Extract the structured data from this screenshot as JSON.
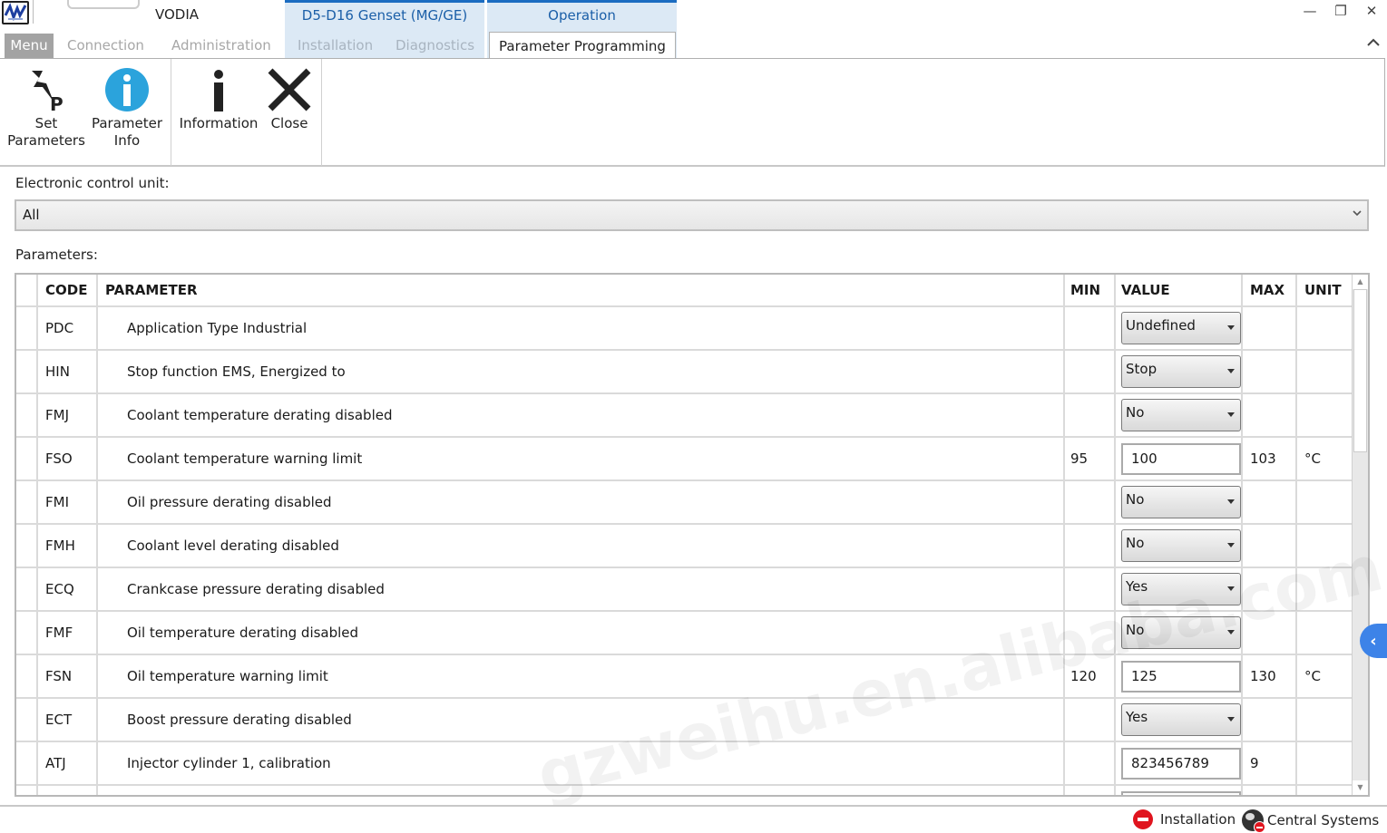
{
  "window": {
    "app_name": "VODIA",
    "context_groups": [
      {
        "title": "D5-D16 Genset (MG/GE)"
      },
      {
        "title": "Operation"
      }
    ],
    "controls": {
      "minimize": "—",
      "restore": "❐",
      "close": "✕"
    }
  },
  "tabs": {
    "menu": "Menu",
    "connection": "Connection",
    "administration": "Administration",
    "installation": "Installation",
    "diagnostics": "Diagnostics",
    "parameter_programming": "Parameter Programming",
    "collapse": "^"
  },
  "ribbon": {
    "set_parameters": {
      "line1": "Set",
      "line2": "Parameters",
      "icon": "set-parameters-icon"
    },
    "parameter_info": {
      "line1": "Parameter",
      "line2": "Info",
      "icon": "info-circle-icon"
    },
    "information": {
      "label": "Information",
      "icon": "info-icon"
    },
    "close": {
      "label": "Close",
      "icon": "close-x-icon"
    }
  },
  "ecu": {
    "label": "Electronic control unit:",
    "selected": "All"
  },
  "parameters": {
    "label": "Parameters:",
    "columns": {
      "code": "CODE",
      "parameter": "PARAMETER",
      "min": "MIN",
      "value": "VALUE",
      "max": "MAX",
      "unit": "UNIT"
    },
    "rows": [
      {
        "code": "PDC",
        "name": "Application Type Industrial",
        "min": "",
        "value": "Undefined",
        "kind": "dropdown",
        "max": "",
        "unit": ""
      },
      {
        "code": "HIN",
        "name": "Stop function EMS, Energized to",
        "min": "",
        "value": "Stop",
        "kind": "dropdown",
        "max": "",
        "unit": ""
      },
      {
        "code": "FMJ",
        "name": "Coolant temperature derating disabled",
        "min": "",
        "value": "No",
        "kind": "dropdown",
        "max": "",
        "unit": ""
      },
      {
        "code": "FSO",
        "name": "Coolant temperature warning limit",
        "min": "95",
        "value": "100",
        "kind": "text",
        "max": "103",
        "unit": "°C"
      },
      {
        "code": "FMI",
        "name": "Oil pressure derating disabled",
        "min": "",
        "value": "No",
        "kind": "dropdown",
        "max": "",
        "unit": ""
      },
      {
        "code": "FMH",
        "name": "Coolant level derating disabled",
        "min": "",
        "value": "No",
        "kind": "dropdown",
        "max": "",
        "unit": ""
      },
      {
        "code": "ECQ",
        "name": "Crankcase pressure derating disabled",
        "min": "",
        "value": "Yes",
        "kind": "dropdown",
        "max": "",
        "unit": ""
      },
      {
        "code": "FMF",
        "name": "Oil temperature derating disabled",
        "min": "",
        "value": "No",
        "kind": "dropdown",
        "max": "",
        "unit": ""
      },
      {
        "code": "FSN",
        "name": "Oil temperature warning limit",
        "min": "120",
        "value": "125",
        "kind": "text",
        "max": "130",
        "unit": "°C"
      },
      {
        "code": "ECT",
        "name": "Boost pressure derating disabled",
        "min": "",
        "value": "Yes",
        "kind": "dropdown",
        "max": "",
        "unit": ""
      },
      {
        "code": "ATJ",
        "name": "Injector cylinder 1, calibration",
        "min": "",
        "value": "823456789",
        "kind": "text",
        "max": "9",
        "unit": ""
      },
      {
        "code": "",
        "name": "",
        "min": "",
        "value": "",
        "kind": "text",
        "max": "",
        "unit": ""
      }
    ]
  },
  "side_panel": {
    "toggle": "‹"
  },
  "statusbar": {
    "installation": "Installation",
    "central_systems": "Central Systems"
  },
  "watermark": "gzweihu.en.alibaba.com"
}
